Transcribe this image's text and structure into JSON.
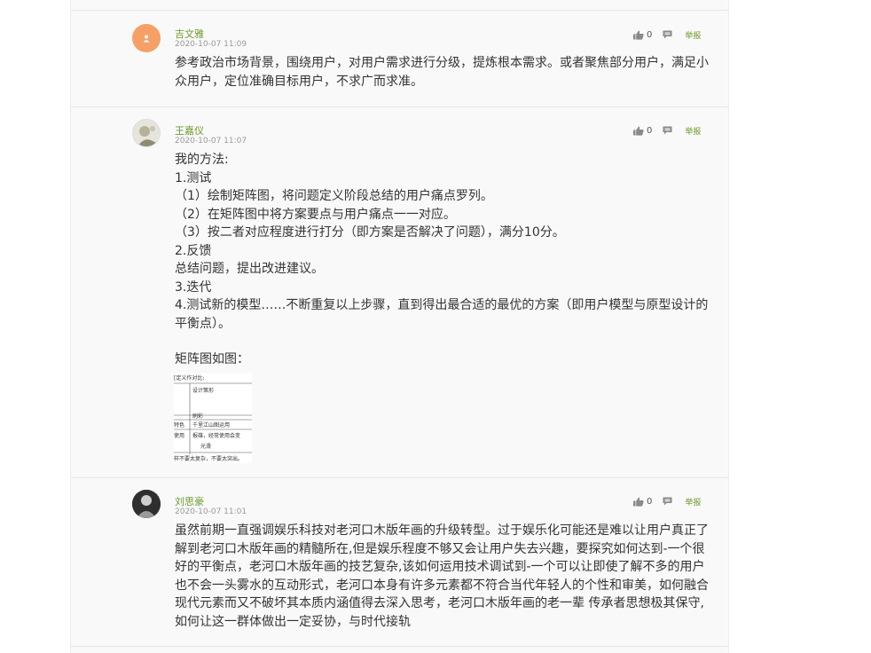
{
  "comments": [
    {
      "name": "吉文雅",
      "time": "2020-10-07 11:09",
      "likes": "0",
      "report": "举报",
      "lines": [
        "参考政治市场背景，围绕用户，对用户需求进行分级，提炼根本需求。或者聚焦部分用户，满足小",
        "众用户，定位准确目标用户，不求广而求准。"
      ]
    },
    {
      "name": "王嘉仪",
      "time": "2020-10-07 11:07",
      "likes": "0",
      "report": "举报",
      "lines": [
        "我的方法:",
        "1.测试",
        "（1）绘制矩阵图，将问题定义阶段总结的用户痛点罗列。",
        "（2）在矩阵图中将方案要点与用户痛点一一对应。",
        "（3）按二者对应程度进行打分（即方案是否解决了问题），满分10分。",
        "2.反馈",
        "总结问题，提出改进建议。",
        "3.迭代",
        "4.测试新的模型……不断重复以上步骤，直到得出最合适的最优的方案（即用户模型与原型设计的",
        "平衡点）。",
        "",
        "矩阵图如图："
      ],
      "image_text": {
        "r1": "[定义作对比:",
        "r2": "设计策形",
        "r3": "刷彩",
        "r4a": "特色",
        "r4b": "千里江山图运用",
        "r5a": "使用",
        "r5b": "报雄，经常使用会变",
        "r6": "光滑",
        "r7": "样不要太复杂，不要太突出。"
      }
    },
    {
      "name": "刘思豪",
      "time": "2020-10-07 11:01",
      "likes": "0",
      "report": "举报",
      "lines": [
        "虽然前期一直强调娱乐科技对老河口木版年画的升级转型。过于娱乐化可能还是难以让用户真正了",
        "解到老河口木版年画的精髓所在,但是娱乐程度不够又会让用户失去兴趣，要探究如何达到-一个很",
        "好的平衡点，老河口木版年画的技艺复杂,该如何运用技术调试到-一个可以让即使了解不多的用户",
        "也不会一头雾水的互动形式，老河口本身有许多元素都不符合当代年轻人的个性和审美，如何融合",
        "现代元素而又不破坏其本质内涵值得去深入思考，老河口木版年画的老一辈 传承者思想极其保守,",
        "如何让这一群体做出一定妥协，与时代接轨"
      ]
    }
  ],
  "colors": {
    "accent": "#6e9a2a",
    "text": "#333333",
    "muted": "#999999",
    "panel": "#f9f9f9"
  }
}
